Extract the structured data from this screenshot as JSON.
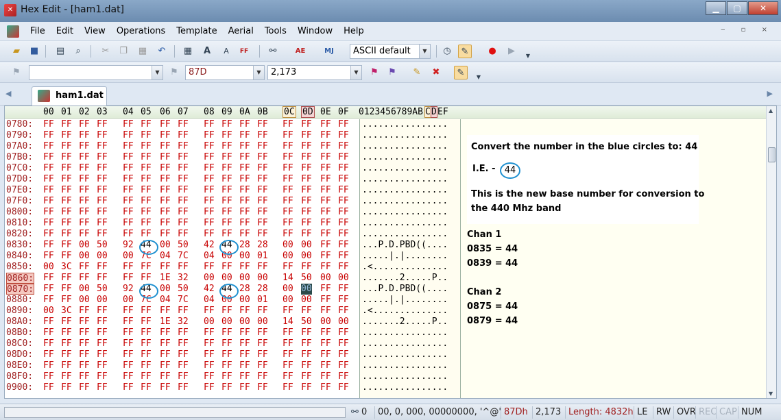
{
  "window": {
    "title": "Hex Edit - [ham1.dat]",
    "minimize": "▁",
    "maximize": "▢",
    "close": "✕"
  },
  "menu": [
    "File",
    "Edit",
    "View",
    "Operations",
    "Template",
    "Aerial",
    "Tools",
    "Window",
    "Help"
  ],
  "mdi_controls": "‒ ▫ ×",
  "toolbar": {
    "charset": "ASCII default",
    "search_text": "",
    "hex_address": "87D",
    "decimal_address": "2,173"
  },
  "tab": {
    "label": "ham1.dat"
  },
  "hex_header": {
    "columns": [
      "00",
      "01",
      "02",
      "03",
      "04",
      "05",
      "06",
      "07",
      "08",
      "09",
      "0A",
      "0B",
      "0C",
      "0D",
      "0E",
      "0F"
    ],
    "ascii": "0123456789AB",
    "ascii_c": "C",
    "ascii_d": "D",
    "ascii_ef": "EF"
  },
  "rows": [
    {
      "addr": "0780:",
      "bytes": [
        "FF",
        "FF",
        "FF",
        "FF",
        "FF",
        "FF",
        "FF",
        "FF",
        "FF",
        "FF",
        "FF",
        "FF",
        "FF",
        "FF",
        "FF",
        "FF"
      ],
      "ascii": "................"
    },
    {
      "addr": "0790:",
      "bytes": [
        "FF",
        "FF",
        "FF",
        "FF",
        "FF",
        "FF",
        "FF",
        "FF",
        "FF",
        "FF",
        "FF",
        "FF",
        "FF",
        "FF",
        "FF",
        "FF"
      ],
      "ascii": "................"
    },
    {
      "addr": "07A0:",
      "bytes": [
        "FF",
        "FF",
        "FF",
        "FF",
        "FF",
        "FF",
        "FF",
        "FF",
        "FF",
        "FF",
        "FF",
        "FF",
        "FF",
        "FF",
        "FF",
        "FF"
      ],
      "ascii": "................"
    },
    {
      "addr": "07B0:",
      "bytes": [
        "FF",
        "FF",
        "FF",
        "FF",
        "FF",
        "FF",
        "FF",
        "FF",
        "FF",
        "FF",
        "FF",
        "FF",
        "FF",
        "FF",
        "FF",
        "FF"
      ],
      "ascii": "................"
    },
    {
      "addr": "07C0:",
      "bytes": [
        "FF",
        "FF",
        "FF",
        "FF",
        "FF",
        "FF",
        "FF",
        "FF",
        "FF",
        "FF",
        "FF",
        "FF",
        "FF",
        "FF",
        "FF",
        "FF"
      ],
      "ascii": "................"
    },
    {
      "addr": "07D0:",
      "bytes": [
        "FF",
        "FF",
        "FF",
        "FF",
        "FF",
        "FF",
        "FF",
        "FF",
        "FF",
        "FF",
        "FF",
        "FF",
        "FF",
        "FF",
        "FF",
        "FF"
      ],
      "ascii": "................"
    },
    {
      "addr": "07E0:",
      "bytes": [
        "FF",
        "FF",
        "FF",
        "FF",
        "FF",
        "FF",
        "FF",
        "FF",
        "FF",
        "FF",
        "FF",
        "FF",
        "FF",
        "FF",
        "FF",
        "FF"
      ],
      "ascii": "................"
    },
    {
      "addr": "07F0:",
      "bytes": [
        "FF",
        "FF",
        "FF",
        "FF",
        "FF",
        "FF",
        "FF",
        "FF",
        "FF",
        "FF",
        "FF",
        "FF",
        "FF",
        "FF",
        "FF",
        "FF"
      ],
      "ascii": "................"
    },
    {
      "addr": "0800:",
      "bytes": [
        "FF",
        "FF",
        "FF",
        "FF",
        "FF",
        "FF",
        "FF",
        "FF",
        "FF",
        "FF",
        "FF",
        "FF",
        "FF",
        "FF",
        "FF",
        "FF"
      ],
      "ascii": "................"
    },
    {
      "addr": "0810:",
      "bytes": [
        "FF",
        "FF",
        "FF",
        "FF",
        "FF",
        "FF",
        "FF",
        "FF",
        "FF",
        "FF",
        "FF",
        "FF",
        "FF",
        "FF",
        "FF",
        "FF"
      ],
      "ascii": "................"
    },
    {
      "addr": "0820:",
      "bytes": [
        "FF",
        "FF",
        "FF",
        "FF",
        "FF",
        "FF",
        "FF",
        "FF",
        "FF",
        "FF",
        "FF",
        "FF",
        "FF",
        "FF",
        "FF",
        "FF"
      ],
      "ascii": "................"
    },
    {
      "addr": "0830:",
      "bytes": [
        "FF",
        "FF",
        "00",
        "50",
        "92",
        "44",
        "00",
        "50",
        "42",
        "44",
        "28",
        "28",
        "00",
        "00",
        "FF",
        "FF"
      ],
      "ascii": "...P.D.PBD((...."
    },
    {
      "addr": "0840:",
      "bytes": [
        "FF",
        "FF",
        "00",
        "00",
        "00",
        "7C",
        "04",
        "7C",
        "04",
        "00",
        "00",
        "01",
        "00",
        "00",
        "FF",
        "FF"
      ],
      "ascii": ".....|.|........"
    },
    {
      "addr": "0850:",
      "bytes": [
        "00",
        "3C",
        "FF",
        "FF",
        "FF",
        "FF",
        "FF",
        "FF",
        "FF",
        "FF",
        "FF",
        "FF",
        "FF",
        "FF",
        "FF",
        "FF"
      ],
      "ascii": ".<.............."
    },
    {
      "addr": "0860:",
      "bytes": [
        "FF",
        "FF",
        "FF",
        "FF",
        "FF",
        "FF",
        "1E",
        "32",
        "00",
        "00",
        "00",
        "00",
        "14",
        "50",
        "00",
        "00"
      ],
      "ascii": ".......2.....P.."
    },
    {
      "addr": "0870:",
      "bytes": [
        "FF",
        "FF",
        "00",
        "50",
        "92",
        "44",
        "00",
        "50",
        "42",
        "44",
        "28",
        "28",
        "00",
        "00",
        "FF",
        "FF"
      ],
      "ascii": "...P.D.PBD((...."
    },
    {
      "addr": "0880:",
      "bytes": [
        "FF",
        "FF",
        "00",
        "00",
        "00",
        "7C",
        "04",
        "7C",
        "04",
        "00",
        "00",
        "01",
        "00",
        "00",
        "FF",
        "FF"
      ],
      "ascii": ".....|.|........"
    },
    {
      "addr": "0890:",
      "bytes": [
        "00",
        "3C",
        "FF",
        "FF",
        "FF",
        "FF",
        "FF",
        "FF",
        "FF",
        "FF",
        "FF",
        "FF",
        "FF",
        "FF",
        "FF",
        "FF"
      ],
      "ascii": ".<.............."
    },
    {
      "addr": "08A0:",
      "bytes": [
        "FF",
        "FF",
        "FF",
        "FF",
        "FF",
        "FF",
        "1E",
        "32",
        "00",
        "00",
        "00",
        "00",
        "14",
        "50",
        "00",
        "00"
      ],
      "ascii": ".......2.....P.."
    },
    {
      "addr": "08B0:",
      "bytes": [
        "FF",
        "FF",
        "FF",
        "FF",
        "FF",
        "FF",
        "FF",
        "FF",
        "FF",
        "FF",
        "FF",
        "FF",
        "FF",
        "FF",
        "FF",
        "FF"
      ],
      "ascii": "................"
    },
    {
      "addr": "08C0:",
      "bytes": [
        "FF",
        "FF",
        "FF",
        "FF",
        "FF",
        "FF",
        "FF",
        "FF",
        "FF",
        "FF",
        "FF",
        "FF",
        "FF",
        "FF",
        "FF",
        "FF"
      ],
      "ascii": "................"
    },
    {
      "addr": "08D0:",
      "bytes": [
        "FF",
        "FF",
        "FF",
        "FF",
        "FF",
        "FF",
        "FF",
        "FF",
        "FF",
        "FF",
        "FF",
        "FF",
        "FF",
        "FF",
        "FF",
        "FF"
      ],
      "ascii": "................"
    },
    {
      "addr": "08E0:",
      "bytes": [
        "FF",
        "FF",
        "FF",
        "FF",
        "FF",
        "FF",
        "FF",
        "FF",
        "FF",
        "FF",
        "FF",
        "FF",
        "FF",
        "FF",
        "FF",
        "FF"
      ],
      "ascii": "................"
    },
    {
      "addr": "08F0:",
      "bytes": [
        "FF",
        "FF",
        "FF",
        "FF",
        "FF",
        "FF",
        "FF",
        "FF",
        "FF",
        "FF",
        "FF",
        "FF",
        "FF",
        "FF",
        "FF",
        "FF"
      ],
      "ascii": "................"
    },
    {
      "addr": "0900:",
      "bytes": [
        "FF",
        "FF",
        "FF",
        "FF",
        "FF",
        "FF",
        "FF",
        "FF",
        "FF",
        "FF",
        "FF",
        "FF",
        "FF",
        "FF",
        "FF",
        "FF"
      ],
      "ascii": "................"
    }
  ],
  "annotation": {
    "line1": "Convert the number in the blue circles to: 44",
    "example_label": "I.E. -",
    "example_value": "44",
    "line2": "This is the new base number for conversion to",
    "line3": "the 440 Mhz band",
    "chan1_title": "Chan 1",
    "chan1_a": "0835 = 44",
    "chan1_b": "0839 = 44",
    "chan2_title": "Chan 2",
    "chan2_a": "0875 = 44",
    "chan2_b": "0879 = 44"
  },
  "status": {
    "bookmark": "0",
    "values": "00, 0, 000, 00000000, '^@'",
    "hex_pos": "87Dh",
    "dec_pos": "2,173",
    "length": "Length: 4832h",
    "endian": "LE",
    "rw": "RW",
    "ovr": "OVR",
    "rec": "REC",
    "cap": "CAP",
    "num": "NUM"
  },
  "colors": {
    "byte_red": "#c80000",
    "ring_blue": "#1e90d0",
    "address_red": "#a02020"
  }
}
